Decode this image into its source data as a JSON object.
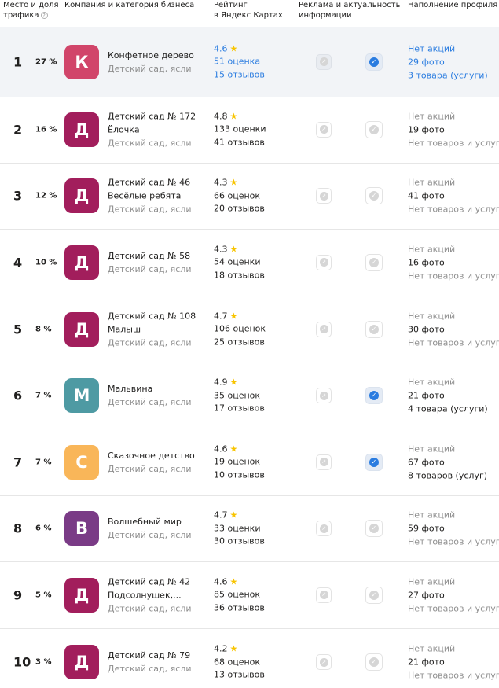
{
  "header": {
    "rank_label_1": "Место и доля",
    "rank_label_2": "трафика",
    "company_label": "Компания и категория бизнеса",
    "rating_label_1": "Рейтинг",
    "rating_label_2": "в Яндекс Картах",
    "ads_label_1": "Реклама и актуальность",
    "ads_label_2": "информации",
    "fill_label": "Наполнение профиля"
  },
  "colors": {
    "highlight_row": "#f2f4f7",
    "link_blue": "#2a7ce0",
    "star": "#f8c400",
    "check_on": "#2a7ce0"
  },
  "rows": [
    {
      "rank": "1",
      "share": "27 %",
      "letter": "К",
      "avatar_color": "#d1456a",
      "name_1": "Конфетное дерево",
      "name_2": "",
      "category": "Детский сад, ясли",
      "rating": "4.6",
      "ratings_count": "51 оценка",
      "reviews": "15 отзывов",
      "verified": true,
      "promos": "Нет акций",
      "photos": "29 фото",
      "goods": "3 товара (услуги)"
    },
    {
      "rank": "2",
      "share": "16 %",
      "letter": "Д",
      "avatar_color": "#a21e5c",
      "name_1": "Детский сад № 172",
      "name_2": "Ёлочка",
      "category": "Детский сад, ясли",
      "rating": "4.8",
      "ratings_count": "133 оценки",
      "reviews": "41 отзывов",
      "verified": false,
      "promos": "Нет акций",
      "photos": "19 фото",
      "goods": "Нет товаров и услуг"
    },
    {
      "rank": "3",
      "share": "12 %",
      "letter": "Д",
      "avatar_color": "#a21e5c",
      "name_1": "Детский сад № 46",
      "name_2": "Весёлые ребята",
      "category": "Детский сад, ясли",
      "rating": "4.3",
      "ratings_count": "66 оценок",
      "reviews": "20 отзывов",
      "verified": false,
      "promos": "Нет акций",
      "photos": "41 фото",
      "goods": "Нет товаров и услуг"
    },
    {
      "rank": "4",
      "share": "10 %",
      "letter": "Д",
      "avatar_color": "#a21e5c",
      "name_1": "Детский сад № 58",
      "name_2": "",
      "category": "Детский сад, ясли",
      "rating": "4.3",
      "ratings_count": "54 оценки",
      "reviews": "18 отзывов",
      "verified": false,
      "promos": "Нет акций",
      "photos": "16 фото",
      "goods": "Нет товаров и услуг"
    },
    {
      "rank": "5",
      "share": "8 %",
      "letter": "Д",
      "avatar_color": "#a21e5c",
      "name_1": "Детский сад № 108",
      "name_2": "Малыш",
      "category": "Детский сад, ясли",
      "rating": "4.7",
      "ratings_count": "106 оценок",
      "reviews": "25 отзывов",
      "verified": false,
      "promos": "Нет акций",
      "photos": "30 фото",
      "goods": "Нет товаров и услуг"
    },
    {
      "rank": "6",
      "share": "7 %",
      "letter": "М",
      "avatar_color": "#4e9aa3",
      "name_1": "Мальвина",
      "name_2": "",
      "category": "Детский сад, ясли",
      "rating": "4.9",
      "ratings_count": "35 оценок",
      "reviews": "17 отзывов",
      "verified": true,
      "promos": "Нет акций",
      "photos": "21 фото",
      "goods": "4 товара (услуги)"
    },
    {
      "rank": "7",
      "share": "7 %",
      "letter": "С",
      "avatar_color": "#f9b659",
      "name_1": "Сказочное детство",
      "name_2": "",
      "category": "Детский сад, ясли",
      "rating": "4.6",
      "ratings_count": "19 оценок",
      "reviews": "10 отзывов",
      "verified": true,
      "promos": "Нет акций",
      "photos": "67 фото",
      "goods": "8 товаров (услуг)"
    },
    {
      "rank": "8",
      "share": "6 %",
      "letter": "В",
      "avatar_color": "#7a3b86",
      "name_1": "Волшебный мир",
      "name_2": "",
      "category": "Детский сад, ясли",
      "rating": "4.7",
      "ratings_count": "33 оценки",
      "reviews": "30 отзывов",
      "verified": false,
      "promos": "Нет акций",
      "photos": "59 фото",
      "goods": "Нет товаров и услуг"
    },
    {
      "rank": "9",
      "share": "5 %",
      "letter": "Д",
      "avatar_color": "#a21e5c",
      "name_1": "Детский сад № 42",
      "name_2": "Подсолнушек,...",
      "category": "Детский сад, ясли",
      "rating": "4.6",
      "ratings_count": "85 оценок",
      "reviews": "36 отзывов",
      "verified": false,
      "promos": "Нет акций",
      "photos": "27 фото",
      "goods": "Нет товаров и услуг"
    },
    {
      "rank": "10",
      "share": "3 %",
      "letter": "Д",
      "avatar_color": "#a21e5c",
      "name_1": "Детский сад № 79",
      "name_2": "",
      "category": "Детский сад, ясли",
      "rating": "4.2",
      "ratings_count": "68 оценок",
      "reviews": "13 отзывов",
      "verified": false,
      "promos": "Нет акций",
      "photos": "21 фото",
      "goods": "Нет товаров и услуг"
    }
  ]
}
